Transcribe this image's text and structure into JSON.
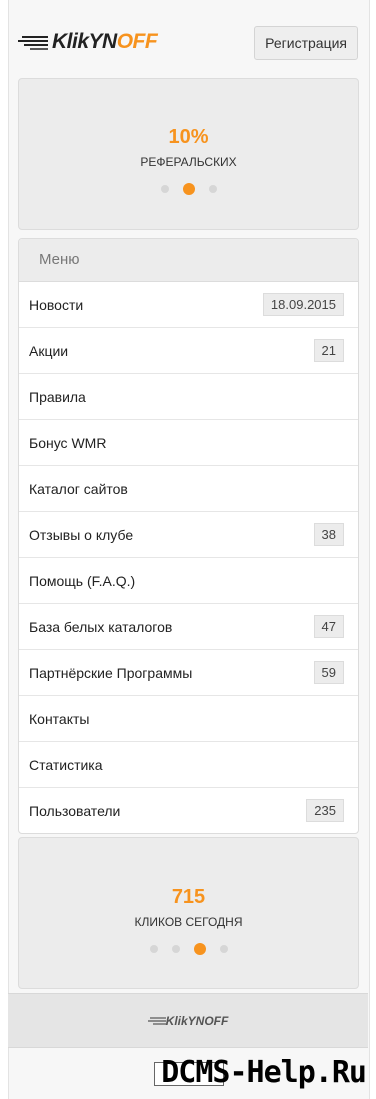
{
  "header": {
    "logo_text_dark": "KlikYN",
    "logo_text_accent": "OFF",
    "register_label": "Регистрация"
  },
  "slider_top": {
    "value": "10%",
    "caption": "РЕФЕРАЛЬСКИХ",
    "dots_total": 3,
    "dot_active": 2
  },
  "menu": {
    "title": "Меню",
    "items": [
      {
        "label": "Новости",
        "badge": "18.09.2015"
      },
      {
        "label": "Акции",
        "badge": "21"
      },
      {
        "label": "Правила",
        "badge": ""
      },
      {
        "label": "Бонус WMR",
        "badge": ""
      },
      {
        "label": "Каталог сайтов",
        "badge": ""
      },
      {
        "label": "Отзывы о клубе",
        "badge": "38"
      },
      {
        "label": "Помощь (F.A.Q.)",
        "badge": ""
      },
      {
        "label": "База белых каталогов",
        "badge": "47"
      },
      {
        "label": "Партнёрские Программы",
        "badge": "59"
      },
      {
        "label": "Контакты",
        "badge": ""
      },
      {
        "label": "Статистика",
        "badge": ""
      },
      {
        "label": "Пользователи",
        "badge": "235"
      }
    ]
  },
  "slider_bottom": {
    "value": "715",
    "caption": "КЛИКОВ СЕГОДНЯ",
    "dots_total": 4,
    "dot_active": 3
  },
  "footer": {
    "logo_text": "KlikYNOFF"
  },
  "watermark": "DCMS-Help.Ru",
  "colors": {
    "accent": "#f7931e",
    "panel": "#ececec"
  }
}
